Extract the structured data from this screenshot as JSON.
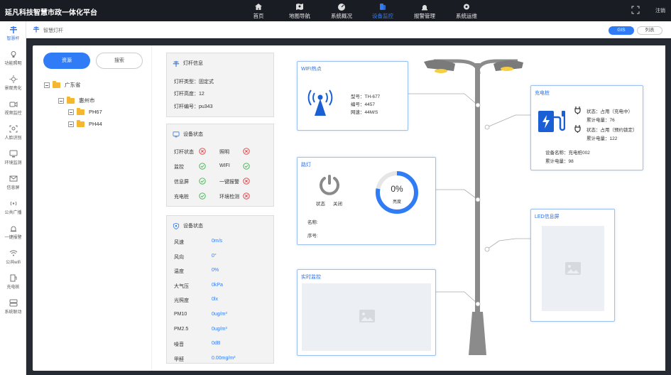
{
  "app": {
    "title": "延凡科技智慧市政一体化平台",
    "logout": "注销"
  },
  "nav": [
    {
      "label": "首页",
      "icon": "home-icon",
      "active": false
    },
    {
      "label": "地图导航",
      "icon": "map-icon",
      "active": false
    },
    {
      "label": "系统概况",
      "icon": "dashboard-icon",
      "active": false
    },
    {
      "label": "设备监控",
      "icon": "device-icon",
      "active": true
    },
    {
      "label": "报警管理",
      "icon": "alarm-icon",
      "active": false
    },
    {
      "label": "系统运维",
      "icon": "gear-icon",
      "active": false
    }
  ],
  "sidebar": [
    {
      "label": "智慧杆",
      "icon": "pole-icon",
      "active": true
    },
    {
      "label": "功能照明",
      "icon": "bulb-icon"
    },
    {
      "label": "景观亮化",
      "icon": "sun-icon"
    },
    {
      "label": "视频监控",
      "icon": "camera-icon"
    },
    {
      "label": "人脸识别",
      "icon": "face-icon"
    },
    {
      "label": "环境监测",
      "icon": "env-icon"
    },
    {
      "label": "信息屏",
      "icon": "mail-icon"
    },
    {
      "label": "公共广播",
      "icon": "broadcast-icon"
    },
    {
      "label": "一键报警",
      "icon": "alarm-icon"
    },
    {
      "label": "公共wifi",
      "icon": "wifi-icon"
    },
    {
      "label": "充电桩",
      "icon": "charger-icon"
    },
    {
      "label": "系统联动",
      "icon": "link-icon"
    }
  ],
  "breadcrumb": {
    "text": "智慧灯杆",
    "gis": "GIS",
    "list": "列表"
  },
  "tree": {
    "tabs": {
      "resource": "资源",
      "search": "搜索"
    },
    "nodes": {
      "province": "广东省",
      "city": "惠州市",
      "ph67": "PH67",
      "ph44": "PH44"
    }
  },
  "pole_info": {
    "title": "灯杆信息",
    "type": "灯杆类型：固定式",
    "height": "灯杆高度：12",
    "number": "灯杆编号：pu343"
  },
  "device_status": {
    "title": "设备状态",
    "items": [
      {
        "label": "灯杆状态",
        "ok": false
      },
      {
        "label": "照明",
        "ok": false
      },
      {
        "label": "监控",
        "ok": true
      },
      {
        "label": "WIFI",
        "ok": true
      },
      {
        "label": "信息屏",
        "ok": true
      },
      {
        "label": "一键报警",
        "ok": false
      },
      {
        "label": "充电桩",
        "ok": true
      },
      {
        "label": "环境检测",
        "ok": false
      }
    ]
  },
  "env_status": {
    "title": "设备状态",
    "rows": [
      {
        "label": "风速",
        "value": "0m/s"
      },
      {
        "label": "风向",
        "value": "0°"
      },
      {
        "label": "温度",
        "value": "0%"
      },
      {
        "label": "大气压",
        "value": "0kPa"
      },
      {
        "label": "光照度",
        "value": "0lx"
      },
      {
        "label": "PM10",
        "value": "0ug/m³"
      },
      {
        "label": "PM2.5",
        "value": "0ug/m³"
      },
      {
        "label": "噪音",
        "value": "0dB"
      },
      {
        "label": "甲醛",
        "value": "0.00mg/m³"
      }
    ]
  },
  "wifi": {
    "title": "WIFI热点",
    "model": "型号：TH-677",
    "code": "编号：4457",
    "speed": "网速：44M/S"
  },
  "lamp": {
    "title": "路灯",
    "state_label": "状态",
    "state_value": "关闭",
    "brightness": "0%",
    "brightness_value": 0,
    "brightness_label": "亮度",
    "name_label": "名称:",
    "serial_label": "序号:"
  },
  "monitor": {
    "title": "实时监控"
  },
  "charger": {
    "title": "充电桩",
    "p1_status": "状态：占用（充电中）",
    "p1_energy": "累计电量：76",
    "p2_status": "状态：占用（预约锁定）",
    "p2_energy": "累计电量：122",
    "device_name": "设备名称：充电桩002",
    "total_energy": "累计电量：98"
  },
  "led": {
    "title": "LED信息屏"
  },
  "colors": {
    "accent": "#2f7cf6",
    "ok": "#3bb54a",
    "error": "#e0383e"
  }
}
